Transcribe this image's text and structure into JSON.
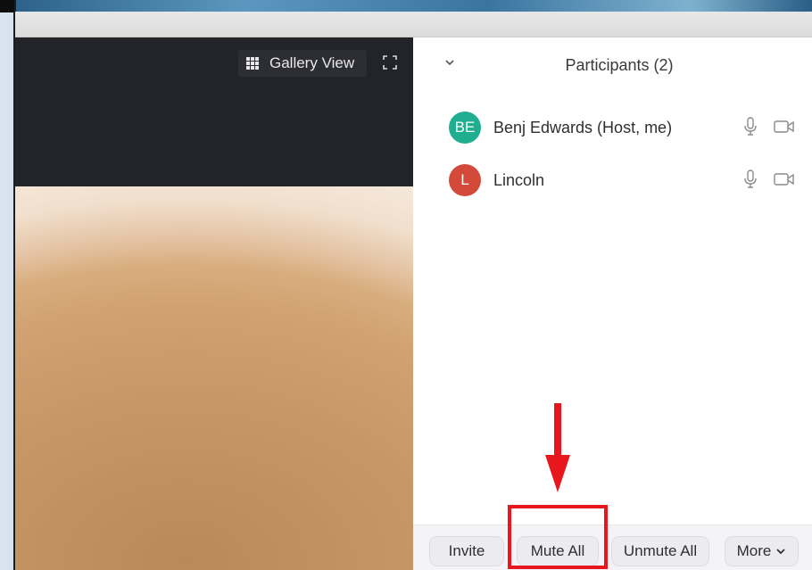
{
  "video": {
    "gallery_view_label": "Gallery View",
    "grid_icon": "grid-icon",
    "fullscreen_icon": "fullscreen-icon"
  },
  "participants_panel": {
    "title": "Participants (2)",
    "collapse_icon": "chevron-down-icon",
    "participants": [
      {
        "initials": "BE",
        "name": "Benj Edwards (Host, me)",
        "avatar_color": "#1fae8f",
        "mic_icon": "microphone-icon",
        "video_icon": "video-camera-icon"
      },
      {
        "initials": "L",
        "name": "Lincoln",
        "avatar_color": "#d44a3a",
        "mic_icon": "microphone-icon",
        "video_icon": "video-camera-icon"
      }
    ],
    "footer": {
      "invite_label": "Invite",
      "mute_all_label": "Mute All",
      "unmute_all_label": "Unmute All",
      "more_label": "More",
      "more_icon": "chevron-down-icon"
    }
  },
  "annotation": {
    "color": "#e8171e",
    "target": "Mute All"
  }
}
